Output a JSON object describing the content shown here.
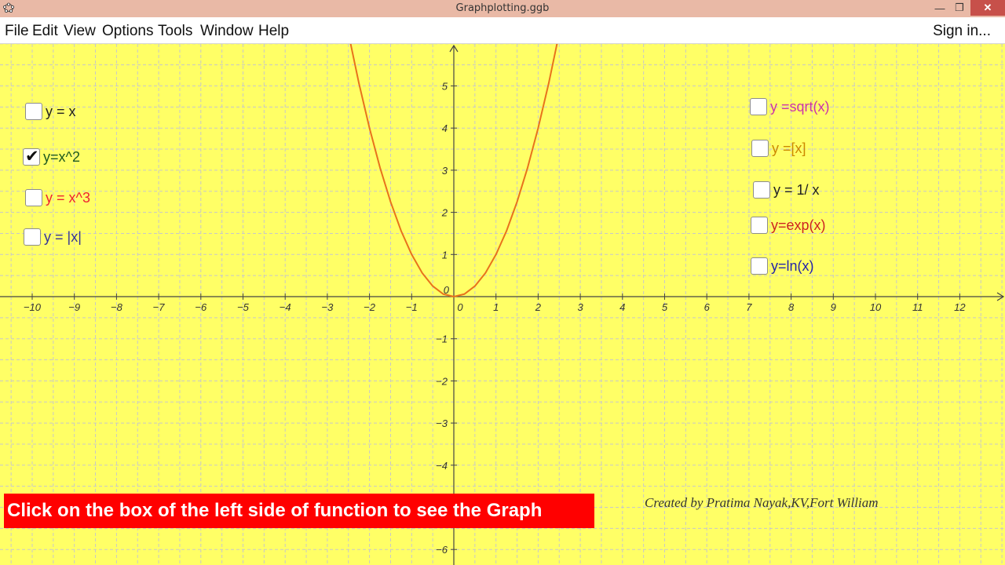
{
  "window": {
    "title": "Graphplotting.ggb",
    "controls": {
      "minimize": "—",
      "restore": "❐",
      "close": "✕"
    },
    "icon": "geogebra-app-icon"
  },
  "menu": {
    "items": [
      "File",
      "Edit",
      "View",
      "Options",
      "Tools",
      "Window",
      "Help"
    ],
    "sign_in": "Sign in..."
  },
  "colors": {
    "background": "#ffff66",
    "curve": "#e8721c",
    "grid": "#c8c8c8",
    "axis": "#444444",
    "instruction_bg": "#ff0000"
  },
  "checkboxes_left": [
    {
      "label": "y = x",
      "checked": false,
      "color": "#222222"
    },
    {
      "label": "y=x^2",
      "checked": true,
      "color": "#1f5a1f"
    },
    {
      "label": "y = x^3",
      "checked": false,
      "color": "#ee2233"
    },
    {
      "label": "y = |x|",
      "checked": false,
      "color": "#333399"
    }
  ],
  "checkboxes_right": [
    {
      "label": "y =sqrt(x)",
      "checked": false,
      "color": "#cc33aa"
    },
    {
      "label": "y =[x]",
      "checked": false,
      "color": "#cc8800"
    },
    {
      "label": "y = 1/ x",
      "checked": false,
      "color": "#222222"
    },
    {
      "label": "y=exp(x)",
      "checked": false,
      "color": "#cc2222"
    },
    {
      "label": "y=ln(x)",
      "checked": false,
      "color": "#2222aa"
    }
  ],
  "instruction": "Click on the box of the left side of function to see the Graph",
  "credit": "Created by Pratima Nayak,KV,Fort William",
  "chart_data": {
    "type": "line",
    "xlim": [
      -10.8,
      13.0
    ],
    "ylim": [
      -6.2,
      6.0
    ],
    "x_ticks": [
      -10,
      -9,
      -8,
      -7,
      -6,
      -5,
      -4,
      -3,
      -2,
      -1,
      0,
      1,
      2,
      3,
      4,
      5,
      6,
      7,
      8,
      9,
      10,
      11,
      12
    ],
    "y_ticks": [
      -6,
      -5,
      -4,
      -3,
      -2,
      -1,
      1,
      2,
      3,
      4,
      5
    ],
    "grid": true,
    "series": [
      {
        "name": "y=x^2",
        "x": [
          -2.5,
          -2.25,
          -2.0,
          -1.75,
          -1.5,
          -1.25,
          -1.0,
          -0.75,
          -0.5,
          -0.25,
          0,
          0.25,
          0.5,
          0.75,
          1.0,
          1.25,
          1.5,
          1.75,
          2.0,
          2.25,
          2.5
        ],
        "y": [
          6.25,
          5.06,
          4.0,
          3.06,
          2.25,
          1.56,
          1.0,
          0.56,
          0.25,
          0.06,
          0,
          0.06,
          0.25,
          0.56,
          1.0,
          1.56,
          2.25,
          3.06,
          4.0,
          5.06,
          6.25
        ]
      }
    ]
  }
}
